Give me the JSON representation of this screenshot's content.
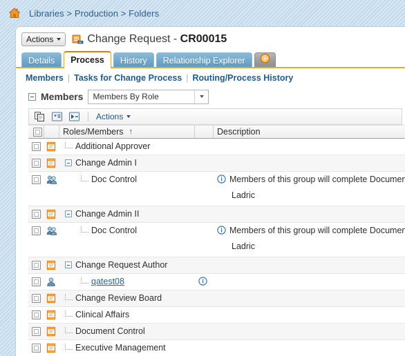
{
  "breadcrumb": {
    "home_icon": "home-icon",
    "text": "Libraries > Production > Folders",
    "items": [
      "Libraries",
      "Production",
      "Folders"
    ]
  },
  "header": {
    "actions_label": "Actions",
    "doc_icon": "change-request-icon",
    "title_prefix": "Change Request - ",
    "title_id": "CR00015"
  },
  "tabs": [
    {
      "label": "Details",
      "active": false
    },
    {
      "label": "Process",
      "active": true
    },
    {
      "label": "History",
      "active": false
    },
    {
      "label": "Relationship Explorer",
      "active": false
    },
    {
      "label": "+",
      "active": false,
      "icon": "add-tab-icon"
    }
  ],
  "subnav": [
    {
      "label": "Members"
    },
    {
      "label": "Tasks for Change Process"
    },
    {
      "label": "Routing/Process History"
    }
  ],
  "members_panel": {
    "title": "Members",
    "view_selected": "Members By Role",
    "view_options": [
      "Members By Role"
    ],
    "toolbar": {
      "icons": [
        "copy-icon",
        "filter-list-icon",
        "expand-all-icon"
      ],
      "actions_label": "Actions"
    }
  },
  "grid": {
    "columns": [
      {
        "key": "check",
        "label": ""
      },
      {
        "key": "icon",
        "label": ""
      },
      {
        "key": "name",
        "label": "Roles/Members",
        "sort": "↑"
      },
      {
        "key": "gap",
        "label": ""
      },
      {
        "key": "desc",
        "label": "Description"
      }
    ],
    "rows": [
      {
        "icon": "role-scroll-icon",
        "indent": 0,
        "expander": false,
        "name": "Additional Approver",
        "is_link": false,
        "desc": "",
        "desc_sub": "",
        "tall": false
      },
      {
        "icon": "role-scroll-icon",
        "indent": 0,
        "expander": true,
        "name": "Change Admin I",
        "is_link": false,
        "desc": "",
        "desc_sub": "",
        "tall": false
      },
      {
        "icon": "group-users-icon",
        "indent": 1,
        "expander": false,
        "name": "Doc Control",
        "is_link": false,
        "desc": "Members of this group will complete Document Control tasks.",
        "desc_sub": "Ladric",
        "desc_icon": "info-icon",
        "tall": true
      },
      {
        "icon": "role-scroll-icon",
        "indent": 0,
        "expander": true,
        "name": "Change Admin II",
        "is_link": false,
        "desc": "",
        "desc_sub": "",
        "tall": false
      },
      {
        "icon": "group-users-icon",
        "indent": 1,
        "expander": false,
        "name": "Doc Control",
        "is_link": false,
        "desc": "Members of this group will complete Document Control tasks.",
        "desc_sub": "Ladric",
        "desc_icon": "info-icon",
        "tall": true
      },
      {
        "icon": "role-scroll-icon",
        "indent": 0,
        "expander": true,
        "name": "Change Request Author",
        "is_link": false,
        "desc": "",
        "desc_sub": "",
        "tall": false
      },
      {
        "icon": "single-user-icon",
        "indent": 1,
        "expander": false,
        "name": "qatest08",
        "is_link": true,
        "desc": "",
        "desc_sub": "",
        "desc_icon": "info-icon",
        "tall": false
      },
      {
        "icon": "role-scroll-icon",
        "indent": 0,
        "expander": false,
        "name": "Change Review Board",
        "is_link": false,
        "desc": "",
        "desc_sub": "",
        "tall": false
      },
      {
        "icon": "role-scroll-icon",
        "indent": 0,
        "expander": false,
        "name": "Clinical Affairs",
        "is_link": false,
        "desc": "",
        "desc_sub": "",
        "tall": false
      },
      {
        "icon": "role-scroll-icon",
        "indent": 0,
        "expander": false,
        "name": "Document Control",
        "is_link": false,
        "desc": "",
        "desc_sub": "",
        "tall": false
      },
      {
        "icon": "role-scroll-icon",
        "indent": 0,
        "expander": false,
        "name": "Executive Management",
        "is_link": false,
        "desc": "",
        "desc_sub": "",
        "tall": false
      }
    ]
  },
  "colors": {
    "accent_orange": "#e07b00",
    "tab_blue": "#74a9cc",
    "link_blue": "#2a6496",
    "page_bg": "#c5dced",
    "tab_underline": "#e0a93f"
  }
}
